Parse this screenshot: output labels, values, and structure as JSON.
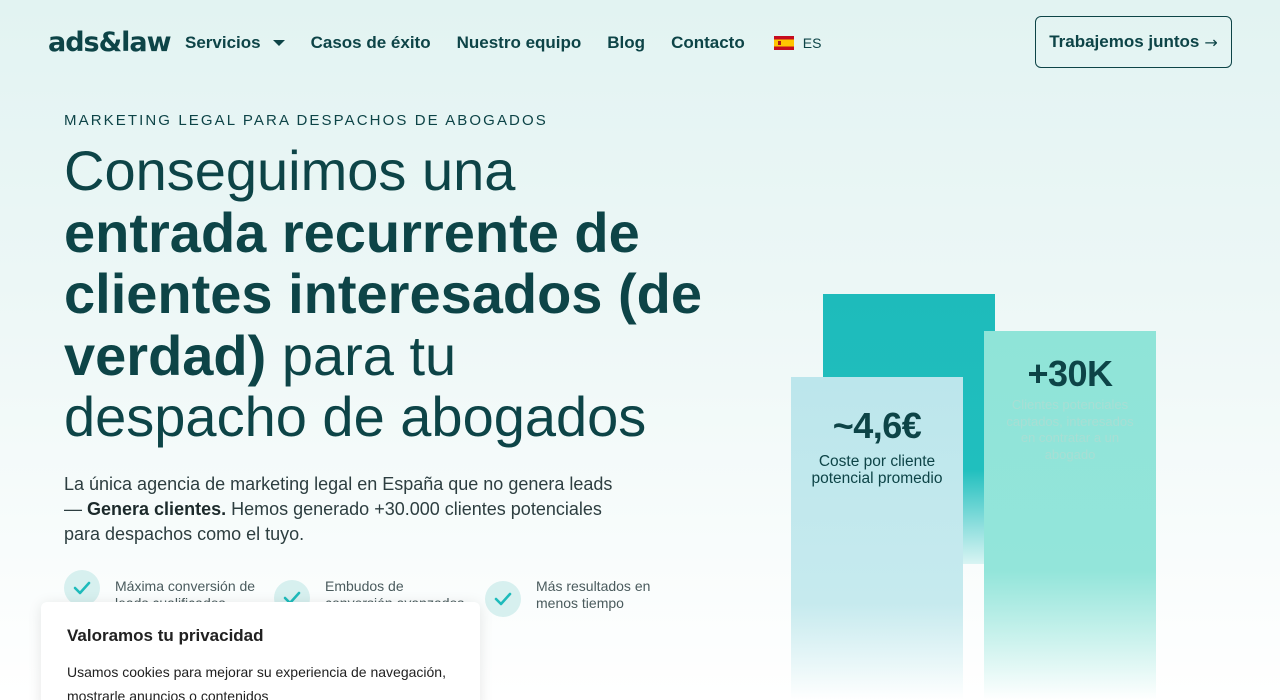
{
  "header": {
    "logo": "ads&law",
    "nav": [
      {
        "label": "Servicios",
        "has_dropdown": true
      },
      {
        "label": "Casos de éxito"
      },
      {
        "label": "Nuestro equipo"
      },
      {
        "label": "Blog"
      },
      {
        "label": "Contacto"
      }
    ],
    "language": {
      "code": "ES",
      "flag": "spain-flag-icon"
    },
    "cta_label": "Trabajemos juntos",
    "cta_icon": "arrow-right-icon"
  },
  "hero": {
    "eyebrow": "MARKETING LEGAL PARA DESPACHOS DE ABOGADOS",
    "headline_1": "Conseguimos una",
    "headline_bold": "entrada recurrente de clientes interesados (de verdad)",
    "headline_2": "para tu despacho de abogados",
    "lead_1": "La única agencia de marketing legal en España que no genera leads —",
    "lead_bold": "Genera clientes.",
    "lead_2": "Hemos generado +30.000 clientes potenciales para despachos como el tuyo.",
    "features": [
      {
        "text": "Máxima conversión de leads cualificados",
        "icon": "check-icon"
      },
      {
        "text": "Embudos de conversión avanzados",
        "icon": "check-icon"
      },
      {
        "text": "Más resultados en menos tiempo",
        "icon": "check-icon"
      }
    ]
  },
  "stats": {
    "left": {
      "value": "~4,6€",
      "label": "Coste por cliente potencial promedio"
    },
    "right": {
      "value": "+30K",
      "label": "Clientes potenciales captados, interesados en contratar a un abogado"
    },
    "colors": {
      "teal": "#1ebbbb",
      "light_blue": "#bce6ec",
      "mint": "#8fe4d8"
    }
  },
  "cookie": {
    "title": "Valoramos tu privacidad",
    "text": "Usamos cookies para mejorar su experiencia de navegación, mostrarle anuncios o contenidos"
  },
  "colors": {
    "brand": "#0d4447",
    "accent": "#1ebbbb"
  }
}
